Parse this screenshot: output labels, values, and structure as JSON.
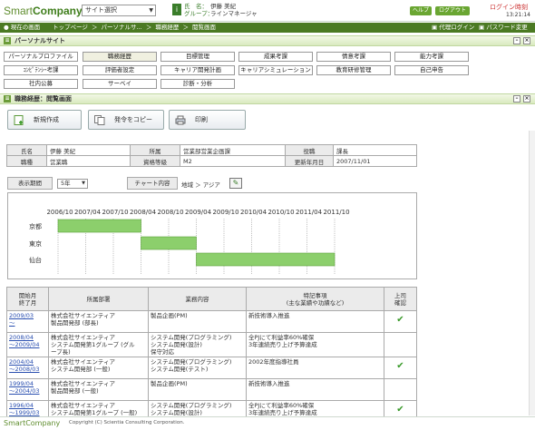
{
  "header": {
    "logo_main": "Smart",
    "logo_sub": "Company",
    "site_select": "サイト選択",
    "name_label": "氏　名：",
    "name_value": "伊藤 美紀",
    "group_label": "グループ：",
    "group_value": "ラインマネージャ",
    "help": "ヘルプ",
    "logout": "ログアウト",
    "login_time_label": "ログイン時刻",
    "login_time": "13:21:14"
  },
  "breadcrumb": {
    "current": "現在の画面",
    "items": [
      "トップページ",
      "＞",
      "パーソナルサ...",
      "＞",
      "職務経歴",
      "＞",
      "閲覧画面"
    ],
    "proxy_login": "代理ログイン",
    "password_change": "パスワード変更"
  },
  "personal_site": {
    "title": "パーソナルサイト",
    "menu": [
      [
        "パーソナルプロファイル",
        "職務経歴",
        "目標管理",
        "成果考課",
        "情意考課",
        "能力考課"
      ],
      [
        "ｺﾝﾋﾟﾃﾝｼｰ考課",
        "評価者設定",
        "キャリア開発計画",
        "キャリアシミュレーション",
        "教育研修管理",
        "自己申告"
      ],
      [
        "社内公募",
        "サーベイ",
        "診断・分析",
        "",
        "",
        ""
      ]
    ]
  },
  "career_section": {
    "title": "職務経歴：閲覧画面",
    "actions": [
      "新規作成",
      "発令をコピー",
      "印刷"
    ]
  },
  "info": {
    "rows": [
      [
        "氏名",
        "伊藤 美紀",
        "所属",
        "営業部営業企画課",
        "役職",
        "課長"
      ],
      [
        "職種",
        "営業職",
        "資格等級",
        "M2",
        "更新年月日",
        "2007/11/01"
      ]
    ]
  },
  "filter": {
    "period_label": "表示期間",
    "period_value": "5年",
    "chart_label": "チャート内容",
    "chart_value": "地域 ＞ アジア"
  },
  "gantt": {
    "ticks": [
      "2006/10",
      "2007/04",
      "2007/10",
      "2008/04",
      "2008/10",
      "2009/04",
      "2009/10",
      "2010/04",
      "2010/10",
      "2011/04",
      "2011/10"
    ],
    "rows": [
      {
        "label": "京都",
        "start": 0,
        "end": 3
      },
      {
        "label": "東京",
        "start": 3,
        "end": 5
      },
      {
        "label": "仙台",
        "start": 5,
        "end": 10
      }
    ],
    "bar_color": "#8ccf6c"
  },
  "history": {
    "headers": [
      "開始月\n終了月",
      "所属部署",
      "業務内容",
      "特記事項\n(主な業績や功績など)",
      "上司\n確認"
    ],
    "rows": [
      {
        "start": "2009/03",
        "end": "～",
        "dept": [
          "株式会社サイエンティア",
          "製品開発部 (部長)"
        ],
        "work": [
          "製品企画(PM)"
        ],
        "note": [
          "新技術導入推進"
        ],
        "ok": true
      },
      {
        "start": "2008/04",
        "end": "～2009/04",
        "dept": [
          "株式会社サイエンティア",
          "システム開発第1グループ (グル",
          "ープ長)"
        ],
        "work": [
          "システム開発(プログラミング)",
          "システム開発(設計)",
          "保守対応"
        ],
        "note": [
          "全PJにて利益率60%確保",
          "3年連続売り上げ予算達成"
        ],
        "ok": false
      },
      {
        "start": "2004/04",
        "end": "～2008/03",
        "dept": [
          "株式会社サイエンティア",
          "システム開発部 (一般)"
        ],
        "work": [
          "システム開発(プログラミング)",
          "システム開発(テスト)"
        ],
        "note": [
          "2002年度指導社員"
        ],
        "ok": true
      },
      {
        "start": "1999/04",
        "end": "～2004/03",
        "dept": [
          "株式会社サイエンティア",
          "製品開発部 (一般)"
        ],
        "work": [
          "製品企画(PM)"
        ],
        "note": [
          "新技術導入推進"
        ],
        "ok": false
      },
      {
        "start": "1996/04",
        "end": "～1999/03",
        "dept": [
          "株式会社サイエンティア",
          "システム開発第1グループ (一般)"
        ],
        "work": [
          "システム開発(プログラミング)",
          "システム開発(設計)"
        ],
        "note": [
          "全PJにて利益率60%確保",
          "3年連続売り上げ予算達成"
        ],
        "ok": true
      }
    ],
    "check_glyph": "✔"
  },
  "footer": {
    "logo": "SmartCompany",
    "copyright": "Copyright (C) Scientia Consulting Corporation."
  }
}
